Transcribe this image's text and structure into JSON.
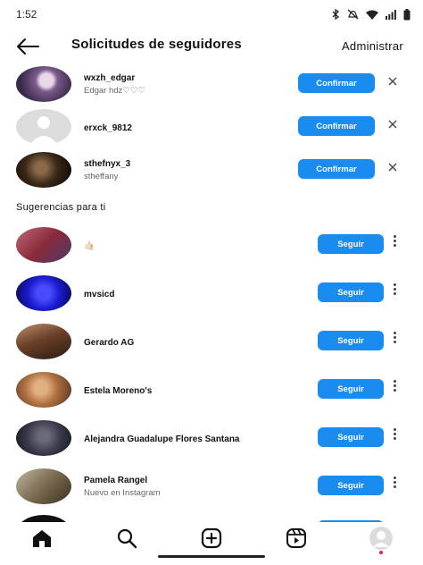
{
  "status_bar": {
    "time": "1:52",
    "icons": [
      "bluetooth-icon",
      "mute-icon",
      "wifi-icon",
      "signal-icon",
      "battery-icon"
    ]
  },
  "header": {
    "title": "Solicitudes de seguidores",
    "action": "Administrar"
  },
  "requests": [
    {
      "username": "wxzh_edgar",
      "name": "Edgar hdz♡♡♡",
      "button": "Confirmar",
      "avatar_color": "#6a5a7a"
    },
    {
      "username": "erxck_9812",
      "name": "",
      "button": "Confirmar",
      "avatar_color": "#dcdcdc"
    },
    {
      "username": "sthefnyx_3",
      "name": "stheffany",
      "button": "Confirmar",
      "avatar_color": "#4a3a2a"
    }
  ],
  "suggestions_title": "Sugerencias para ti",
  "suggestions": [
    {
      "username": "🤙🏻",
      "subtitle": "",
      "button": "Seguir",
      "avatar_color": "#b04a4a"
    },
    {
      "username": "mvsicd",
      "subtitle": "",
      "button": "Seguir",
      "avatar_color": "#1a1acc"
    },
    {
      "username": "Gerardo AG",
      "subtitle": "",
      "button": "Seguir",
      "avatar_color": "#5a4030"
    },
    {
      "username": "Estela Moreno's",
      "subtitle": "",
      "button": "Seguir",
      "avatar_color": "#c08050"
    },
    {
      "username": "Alejandra Guadalupe Flores Santana",
      "subtitle": "",
      "button": "Seguir",
      "avatar_color": "#3a3a4a"
    },
    {
      "username": "Pamela Rangel",
      "subtitle": "Nuevo en Instagram",
      "button": "Seguir",
      "avatar_color": "#8a8070"
    }
  ],
  "colors": {
    "accent": "#1a8cf0",
    "text": "#111111",
    "muted": "#666666"
  },
  "bottom_nav": [
    "home-icon",
    "search-icon",
    "add-post-icon",
    "reels-icon",
    "profile-avatar"
  ]
}
